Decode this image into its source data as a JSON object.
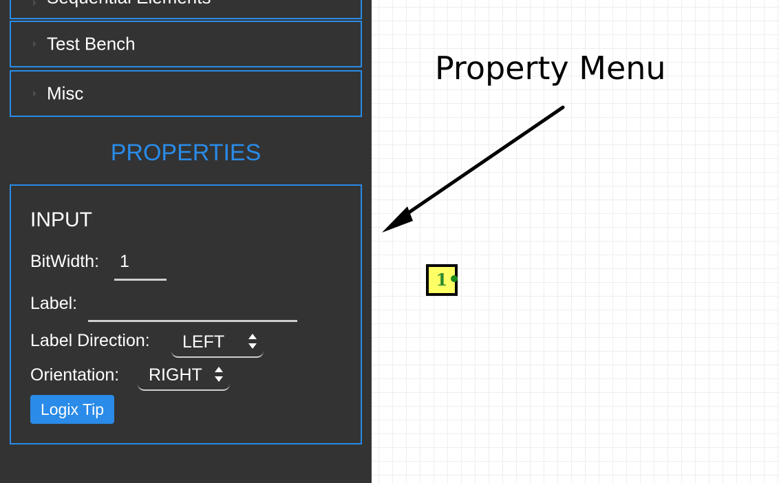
{
  "sidebar": {
    "categories": [
      {
        "label": "Sequential Elements"
      },
      {
        "label": "Test Bench"
      },
      {
        "label": "Misc"
      }
    ],
    "properties_title": "PROPERTIES",
    "properties_panel": {
      "element_title": "INPUT",
      "bitwidth_label": "BitWidth:",
      "bitwidth_value": "1",
      "label_label": "Label:",
      "label_value": "",
      "label_direction_label": "Label Direction:",
      "label_direction_value": "LEFT",
      "orientation_label": "Orientation:",
      "orientation_value": "RIGHT",
      "tip_button_label": "Logix Tip"
    }
  },
  "canvas": {
    "annotation_text": "Property Menu",
    "input_node_value": "1"
  },
  "colors": {
    "sidebar_bg": "#333333",
    "accent_blue": "#2a8be8",
    "node_fill": "#ffff66",
    "node_text": "#2e8b2e",
    "port": "#1a8a1a"
  },
  "icons": {
    "expand": "triangle-right-icon",
    "select_arrows": "updown-arrows-icon",
    "annotation": "arrow-icon"
  }
}
